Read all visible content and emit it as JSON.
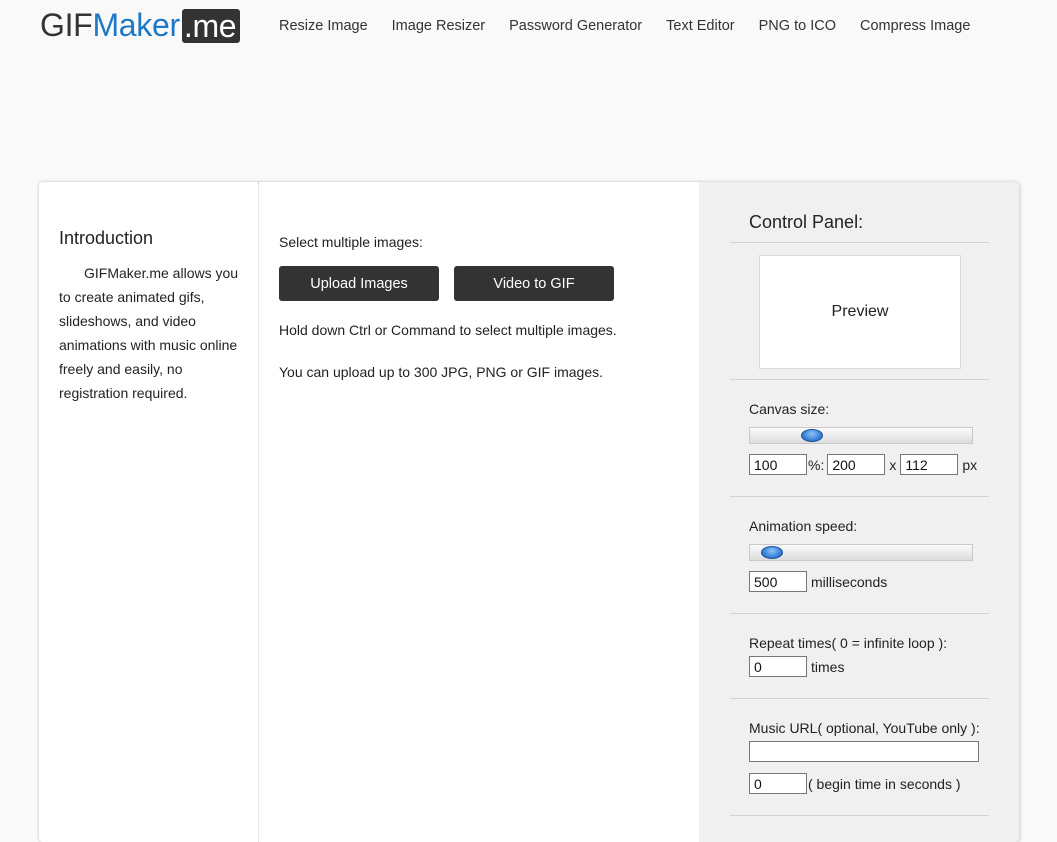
{
  "header": {
    "logo": {
      "part1": "GIF",
      "part2": "Maker",
      "part3": ".me"
    },
    "nav": [
      "Resize Image",
      "Image Resizer",
      "Password Generator",
      "Text Editor",
      "PNG to ICO",
      "Compress Image"
    ]
  },
  "intro": {
    "title": "Introduction",
    "text": "GIFMaker.me allows you to create animated gifs, slideshows, and video animations with music online freely and easily, no registration required."
  },
  "main": {
    "select_label": "Select multiple images:",
    "upload_button": "Upload Images",
    "video_button": "Video to GIF",
    "hint1": "Hold down Ctrl or Command to select multiple images.",
    "hint2": "You can upload up to 300 JPG, PNG or GIF images."
  },
  "panel": {
    "title": "Control Panel:",
    "preview": "Preview",
    "canvas": {
      "label": "Canvas size:",
      "slider_fraction": 0.28,
      "percent": "100",
      "percent_suffix": "%:",
      "width": "200",
      "x_sep": "x",
      "height": "112",
      "unit": "px"
    },
    "speed": {
      "label": "Animation speed:",
      "slider_fraction": 0.1,
      "value": "500",
      "unit": "milliseconds"
    },
    "repeat": {
      "label": "Repeat times( 0 = infinite loop ):",
      "value": "0",
      "unit": "times"
    },
    "music": {
      "label": "Music URL( optional, YouTube only ):",
      "url_value": "",
      "begin_value": "0",
      "begin_unit": "( begin time in seconds )"
    }
  },
  "colors": {
    "brand_blue": "#1e78c8",
    "brand_dark": "#333333",
    "panel_bg": "#f0f0f0"
  }
}
